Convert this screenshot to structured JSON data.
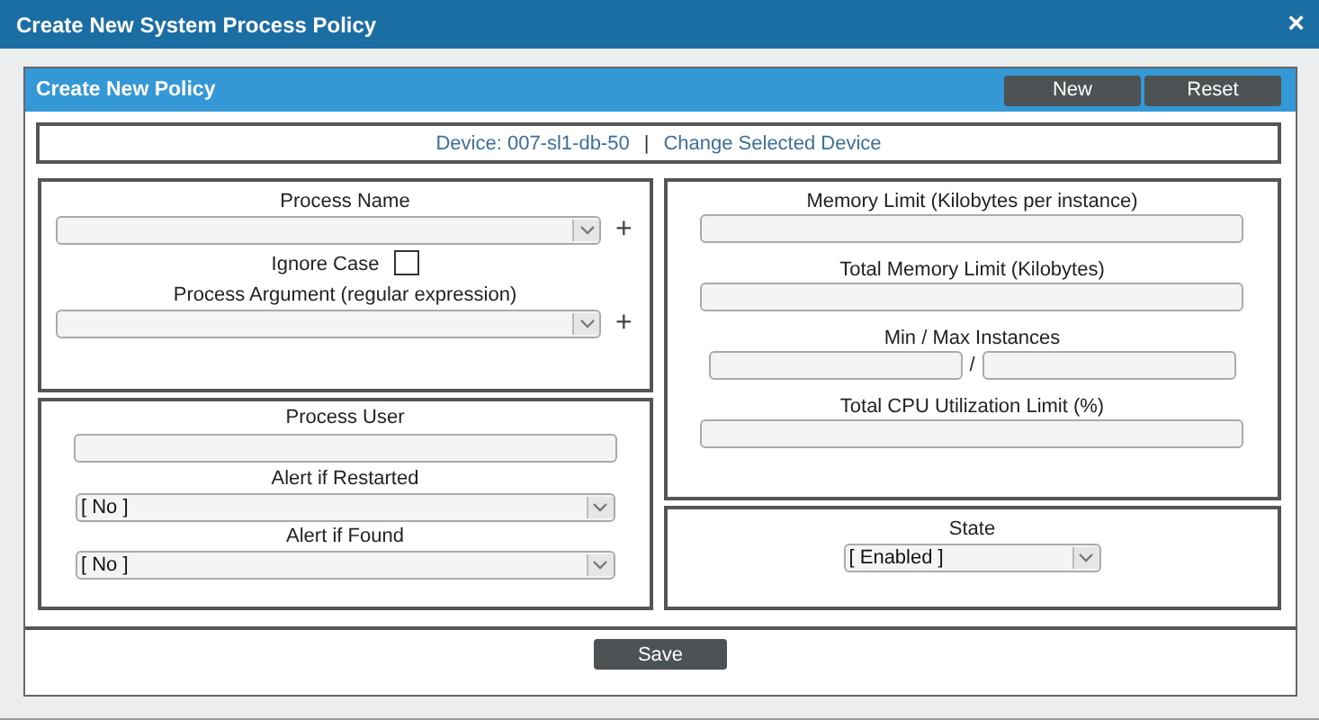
{
  "window": {
    "title": "Create New System Process Policy",
    "close": "×"
  },
  "panel": {
    "title": "Create New Policy",
    "buttons": [
      "New",
      "Reset"
    ]
  },
  "device": {
    "label": "Device: 007-sl1-db-50",
    "separator": "|",
    "link": "Change Selected Device"
  },
  "left_sections": [
    {
      "fields": [
        {
          "kind": "select",
          "label": "Process Name",
          "add": "+"
        },
        {
          "kind": "checkbox",
          "label": "Ignore Case",
          "checked": false
        },
        {
          "kind": "select",
          "label": "Process Argument (regular expression)",
          "add": "+"
        }
      ]
    },
    {
      "fields": [
        {
          "kind": "text",
          "label": "Process User"
        },
        {
          "kind": "select",
          "label": "Alert if Restarted",
          "value": "[ No ]"
        },
        {
          "kind": "select",
          "label": "Alert if Found",
          "value": "[ No ]"
        }
      ]
    }
  ],
  "right_sections": [
    {
      "fields": [
        {
          "kind": "text",
          "label": "Memory Limit (Kilobytes per instance)"
        },
        {
          "kind": "text",
          "label": "Total Memory Limit (Kilobytes)"
        },
        {
          "kind": "range",
          "label": "Min / Max Instances",
          "separator": "/"
        },
        {
          "kind": "text",
          "label": "Total CPU Utilization Limit (%)"
        }
      ]
    },
    {
      "fields": [
        {
          "kind": "select",
          "label": "State",
          "value": "[ Enabled ]"
        }
      ]
    }
  ],
  "save_button": "Save"
}
